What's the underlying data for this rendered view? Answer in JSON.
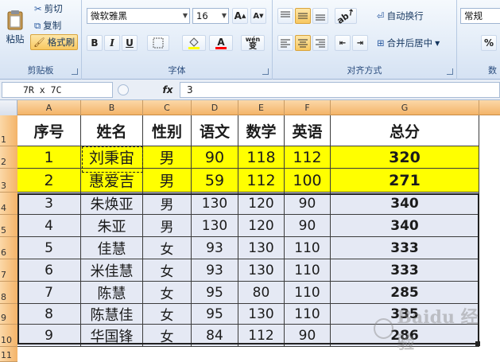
{
  "ribbon": {
    "clipboard": {
      "label": "剪贴板",
      "paste_label": "粘贴",
      "cut_label": "剪切",
      "copy_label": "复制",
      "format_painter_label": "格式刷"
    },
    "font": {
      "label": "字体",
      "font_name": "微软雅黑",
      "font_size": "16",
      "grow_label": "A",
      "shrink_label": "A",
      "bold_label": "B",
      "italic_label": "I",
      "underline_label": "U",
      "fill_color": "#ffff00",
      "font_color": "#ff0000",
      "wen_label": "wén",
      "phonetic_label": "变"
    },
    "alignment": {
      "label": "对齐方式",
      "wrap_text_label": "自动换行",
      "merge_center_label": "合并后居中"
    },
    "number": {
      "label": "数",
      "format_value": "常规",
      "percent_label": "%"
    }
  },
  "formula_bar": {
    "name_box": "7R x 7C",
    "fx_label": "fx",
    "formula_value": "3"
  },
  "columns": [
    "A",
    "B",
    "C",
    "D",
    "E",
    "F",
    "G"
  ],
  "row_numbers": [
    "1",
    "2",
    "3",
    "4",
    "5",
    "6",
    "7",
    "8",
    "9",
    "10",
    "11"
  ],
  "table": {
    "headers": [
      "序号",
      "姓名",
      "性别",
      "语文",
      "数学",
      "英语",
      "总分"
    ],
    "rows": [
      [
        "1",
        "刘秉宙",
        "男",
        "90",
        "118",
        "112",
        "320"
      ],
      [
        "2",
        "惠爱吉",
        "男",
        "59",
        "112",
        "100",
        "271"
      ],
      [
        "3",
        "朱焕亚",
        "男",
        "130",
        "120",
        "90",
        "340"
      ],
      [
        "4",
        "朱亚",
        "男",
        "130",
        "120",
        "90",
        "340"
      ],
      [
        "5",
        "佳慧",
        "女",
        "93",
        "130",
        "110",
        "333"
      ],
      [
        "6",
        "米佳慧",
        "女",
        "93",
        "130",
        "110",
        "333"
      ],
      [
        "7",
        "陈慧",
        "女",
        "95",
        "80",
        "110",
        "285"
      ],
      [
        "8",
        "陈慧佳",
        "女",
        "95",
        "130",
        "110",
        "335"
      ],
      [
        "9",
        "华国锋",
        "女",
        "84",
        "112",
        "90",
        "286"
      ]
    ]
  },
  "colors": {
    "highlight_row": "#ffff00",
    "selection_fill": "#e5e9f4",
    "header_orange": "#f4b469"
  },
  "watermark": "Baidu 经验"
}
